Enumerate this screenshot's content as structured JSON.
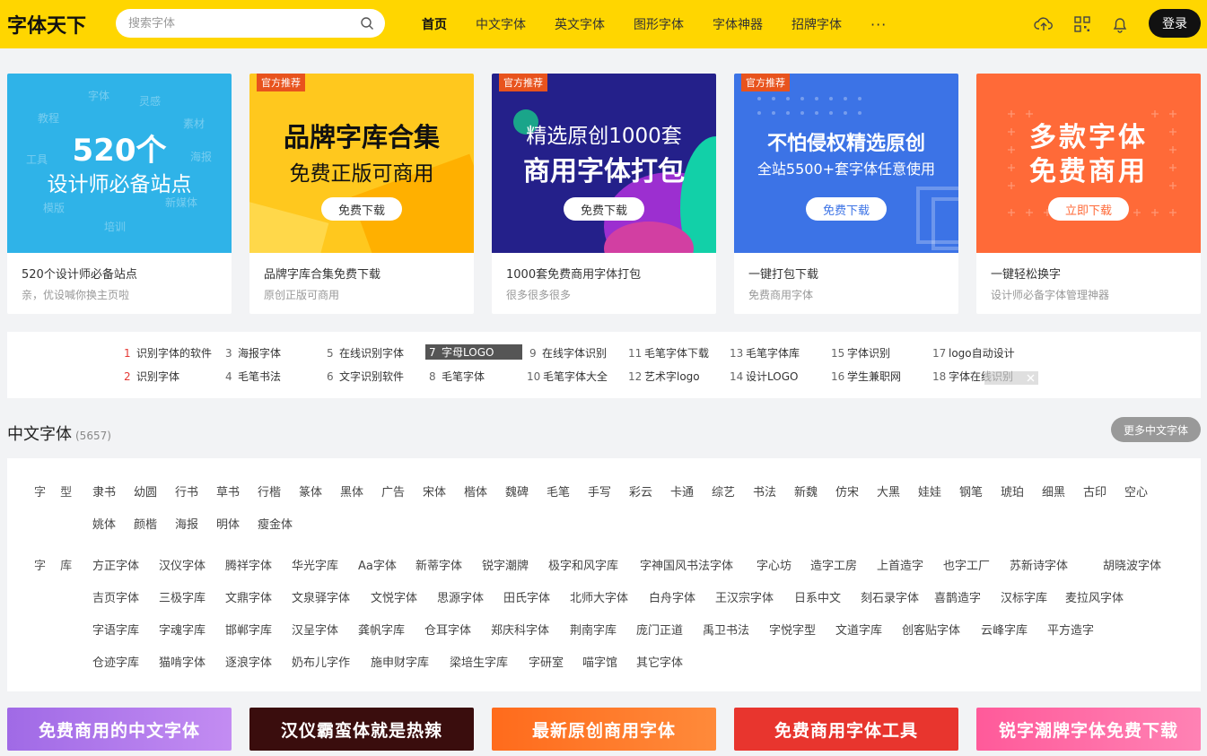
{
  "header": {
    "logo": "字体天下",
    "search_placeholder": "搜索字体",
    "nav": [
      "首页",
      "中文字体",
      "英文字体",
      "图形字体",
      "字体神器",
      "招牌字体"
    ],
    "more": "···",
    "login": "登录"
  },
  "cards": [
    {
      "banner_line1": "520个",
      "banner_line2": "设计师必备站点",
      "faint_words": [
        "字体",
        "灵感",
        "教程",
        "素材",
        "工具",
        "模版",
        "培训",
        "新媒体",
        "海报"
      ],
      "title": "520个设计师必备站点",
      "subtitle": "亲，优设喊你换主页啦"
    },
    {
      "tag": "官方推荐",
      "banner_line1": "品牌字库合集",
      "banner_line2": "免费正版可商用",
      "button": "免费下载",
      "title": "品牌字库合集免费下载",
      "subtitle": "原创正版可商用"
    },
    {
      "tag": "官方推荐",
      "banner_line1": "精选原创1000套",
      "banner_line2": "商用字体打包",
      "button": "免费下载",
      "title": "1000套免费商用字体打包",
      "subtitle": "很多很多很多"
    },
    {
      "tag": "官方推荐",
      "banner_line1": "不怕侵权精选原创",
      "banner_line2": "全站5500+套字体任意使用",
      "button": "免费下载",
      "title": "一键打包下载",
      "subtitle": "免费商用字体"
    },
    {
      "banner_line1": "多款字体",
      "banner_line2": "免费商用",
      "button": "立即下载",
      "title": "一键轻松换字",
      "subtitle": "设计师必备字体管理神器"
    }
  ],
  "hot": [
    {
      "n": "1",
      "t": "识别字体的软件"
    },
    {
      "n": "2",
      "t": "识别字体"
    },
    {
      "n": "3",
      "t": "海报字体"
    },
    {
      "n": "4",
      "t": "毛笔书法"
    },
    {
      "n": "5",
      "t": "在线识别字体"
    },
    {
      "n": "6",
      "t": "文字识别软件"
    },
    {
      "n": "7",
      "t": "字母LOGO"
    },
    {
      "n": "8",
      "t": "毛笔字体"
    },
    {
      "n": "9",
      "t": "在线字体识别"
    },
    {
      "n": "10",
      "t": "毛笔字体大全"
    },
    {
      "n": "11",
      "t": "毛笔字体下载"
    },
    {
      "n": "12",
      "t": "艺术字logo"
    },
    {
      "n": "13",
      "t": "毛笔字体库"
    },
    {
      "n": "14",
      "t": "设计LOGO"
    },
    {
      "n": "15",
      "t": "字体识别"
    },
    {
      "n": "16",
      "t": "学生兼职网"
    },
    {
      "n": "17",
      "t": "logo自动设计"
    },
    {
      "n": "18",
      "t": "字体在线识别"
    }
  ],
  "section": {
    "title": "中文字体",
    "count": "(5657)",
    "more": "更多中文字体",
    "type_label": "字 型",
    "lib_label": "字 库",
    "types": [
      "隶书",
      "幼圆",
      "行书",
      "草书",
      "行楷",
      "篆体",
      "黑体",
      "广告",
      "宋体",
      "楷体",
      "魏碑",
      "毛笔",
      "手写",
      "彩云",
      "卡通",
      "综艺",
      "书法",
      "新魏",
      "仿宋",
      "大黑",
      "娃娃",
      "钢笔",
      "琥珀",
      "细黑",
      "古印",
      "空心",
      "姚体",
      "颜楷",
      "海报",
      "明体",
      "瘦金体"
    ],
    "libs": [
      [
        "方正字体",
        "汉仪字体",
        "腾祥字体",
        "华光字库",
        "Aa字体",
        "新蒂字体",
        "锐字潮牌",
        "极字和风字库",
        "字神国风书法字体",
        "字心坊",
        "造字工房",
        "上首造字",
        "也字工厂",
        "苏新诗字体",
        "胡晓波字体"
      ],
      [
        "吉页字体",
        "三极字库",
        "文鼎字体",
        "文泉驿字体",
        "文悦字体",
        "思源字体",
        "田氏字体",
        "北师大字体",
        "白舟字体",
        "王汉宗字体",
        "日系中文",
        "刻石录字体",
        "喜鹊造字",
        "汉标字库",
        "麦拉风字体"
      ],
      [
        "字语字库",
        "字魂字库",
        "邯郸字库",
        "汉呈字体",
        "龚帆字库",
        "仓耳字体",
        "郑庆科字体",
        "荆南字库",
        "庞门正道",
        "禹卫书法",
        "字悦字型",
        "文道字库",
        "创客贴字体",
        "云峰字库",
        "平方造字"
      ],
      [
        "仓迹字库",
        "猫啃字体",
        "逐浪字体",
        "奶布儿字作",
        "施申财字库",
        "梁培生字库",
        "字研室",
        "喵字馆",
        "其它字体"
      ]
    ]
  },
  "bottom_banners": [
    "免费商用的中文字体",
    "汉仪霸蛮体就是热辣",
    "最新原创商用字体",
    "免费商用字体工具",
    "锐字潮牌字体免费下载"
  ],
  "colors": {
    "header": "#ffd600",
    "card1": "#2fb3e8",
    "card2": "#ffc81e",
    "card3": "#24208a",
    "card4": "#3c73e6",
    "card5": "#ff6a38"
  }
}
